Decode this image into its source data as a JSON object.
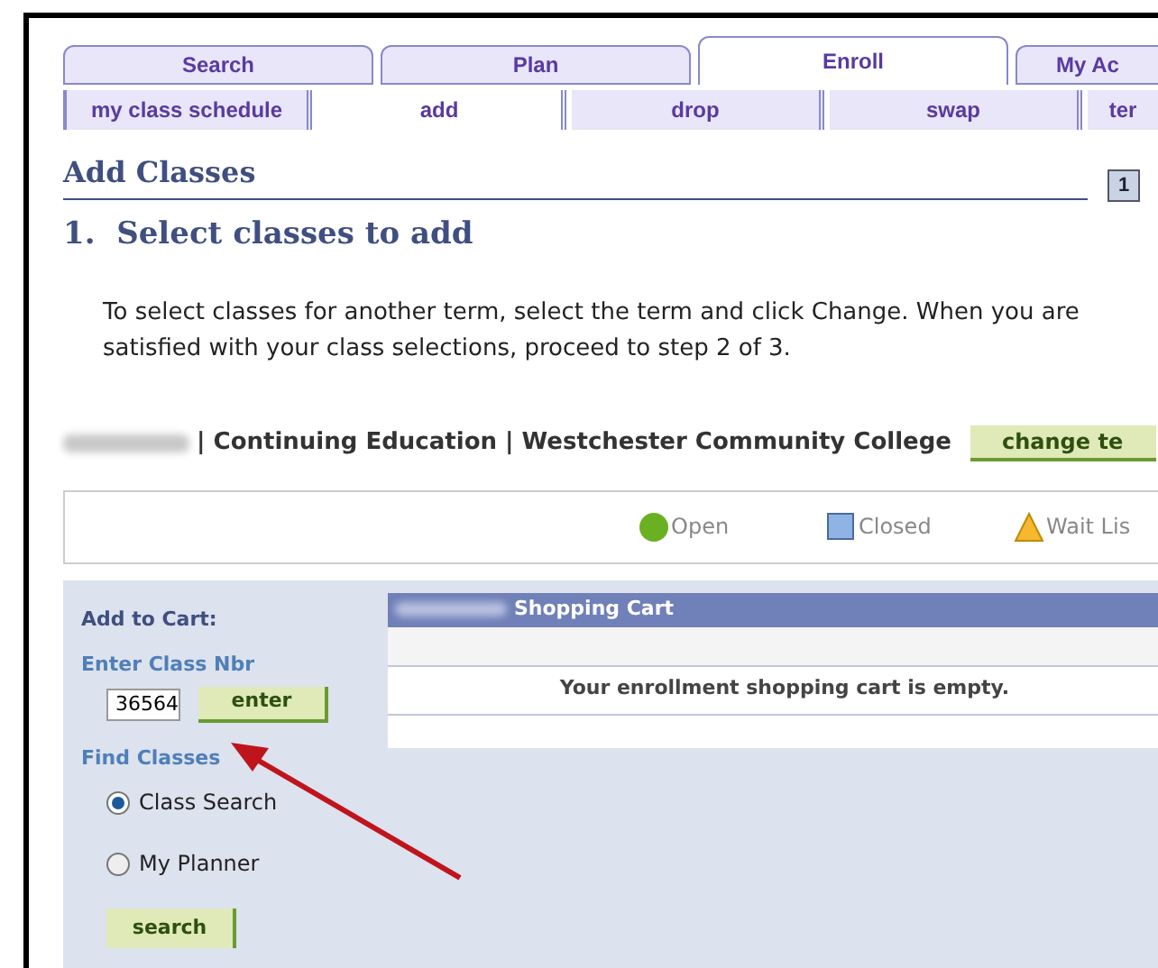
{
  "tabs": [
    {
      "label": "Search",
      "selected": false
    },
    {
      "label": "Plan",
      "selected": false
    },
    {
      "label": "Enroll",
      "selected": true
    },
    {
      "label": "My Ac",
      "selected": false
    }
  ],
  "subtabs": [
    {
      "label": "my class schedule",
      "selected": false
    },
    {
      "label": "add",
      "selected": true
    },
    {
      "label": "drop",
      "selected": false
    },
    {
      "label": "swap",
      "selected": false
    },
    {
      "label": "ter",
      "selected": false
    }
  ],
  "page_title": "Add Classes",
  "step_indicator": "1",
  "step_title": "1.  Select classes to add",
  "instructions": "To select classes for another term, select the term and click Change.  When you are satisfied with your class selections, proceed to step 2 of 3.",
  "term_line": "| Continuing Education | Westchester Community College",
  "change_term_button": "change te",
  "legend": [
    {
      "kind": "circle",
      "label": "Open",
      "color": "#6ab023"
    },
    {
      "kind": "square",
      "label": "Closed",
      "color": "#8fb4e3"
    },
    {
      "kind": "triangle",
      "label": "Wait Lis",
      "color": "#f5b82e"
    }
  ],
  "add_to_cart": {
    "heading": "Add to Cart:",
    "class_nbr_label": "Enter Class Nbr",
    "class_nbr_value": "36564",
    "enter_button": "enter",
    "find_label": "Find Classes",
    "options": [
      {
        "label": "Class Search",
        "selected": true
      },
      {
        "label": "My Planner",
        "selected": false
      }
    ],
    "search_button": "search"
  },
  "shopping_cart": {
    "title": "Shopping Cart",
    "message": "Your enrollment shopping cart is empty."
  }
}
